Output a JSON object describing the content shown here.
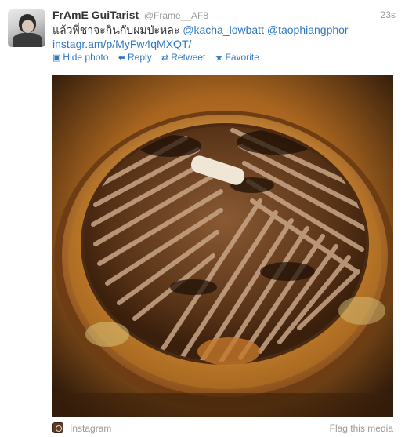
{
  "tweet": {
    "fullname": "FrAmE GuiTarist",
    "username": "@Frame__AF8",
    "timestamp": "23s",
    "text_thai": "แล้วพี่ชาจะกินกับผมป่ะหละ ",
    "mention1": "@kacha_lowbatt",
    "mention2": "@taophiangphor",
    "link": "instagr.am/p/MyFw4qMXQT/"
  },
  "actions": {
    "hide_photo": "Hide photo",
    "reply": "Reply",
    "retweet": "Retweet",
    "favorite": "Favorite"
  },
  "media": {
    "source": "Instagram",
    "flag": "Flag this media"
  },
  "colors": {
    "link": "#2f79c1",
    "muted": "#999999",
    "text": "#333333"
  }
}
